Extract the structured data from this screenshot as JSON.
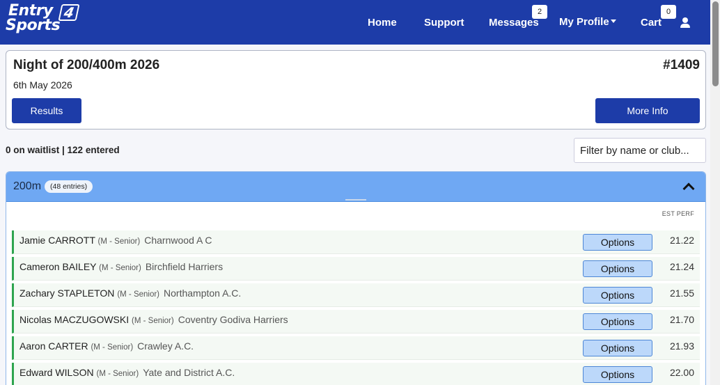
{
  "nav": {
    "logo_line1": "Entry",
    "logo_four": "4",
    "logo_line2": "Sports",
    "home": "Home",
    "support": "Support",
    "messages": "Messages",
    "messages_count": "2",
    "my_profile": "My Profile",
    "cart": "Cart",
    "cart_count": "0"
  },
  "event": {
    "title": "Night of 200/400m 2026",
    "id": "#1409",
    "date": "6th May 2026",
    "results_label": "Results",
    "more_info_label": "More Info"
  },
  "summary": "0 on waitlist | 122 entered",
  "filter": {
    "placeholder": "Filter by name or club..."
  },
  "panel": {
    "title": "200m",
    "entries": "(48 entries)",
    "col_header": "EST PERF",
    "rows": [
      {
        "name": "Jamie CARROTT",
        "category": "(M - Senior)",
        "club": "Charnwood A C",
        "option": "Options",
        "perf": "21.22"
      },
      {
        "name": "Cameron BAILEY",
        "category": "(M - Senior)",
        "club": "Birchfield Harriers",
        "option": "Options",
        "perf": "21.24"
      },
      {
        "name": "Zachary STAPLETON",
        "category": "(M - Senior)",
        "club": "Northampton A.C.",
        "option": "Options",
        "perf": "21.55"
      },
      {
        "name": "Nicolas MACZUGOWSKI",
        "category": "(M - Senior)",
        "club": "Coventry Godiva Harriers",
        "option": "Options",
        "perf": "21.70"
      },
      {
        "name": "Aaron CARTER",
        "category": "(M - Senior)",
        "club": "Crawley A.C.",
        "option": "Options",
        "perf": "21.93"
      },
      {
        "name": "Edward WILSON",
        "category": "(M - Senior)",
        "club": "Yate and District A.C.",
        "option": "Options",
        "perf": "22.00"
      }
    ]
  },
  "colors": {
    "nav_bg": "#1d3ca8",
    "panel_header": "#6fa8f3",
    "option_button": "#bcd8fa",
    "row_accent": "#2ea44f"
  }
}
